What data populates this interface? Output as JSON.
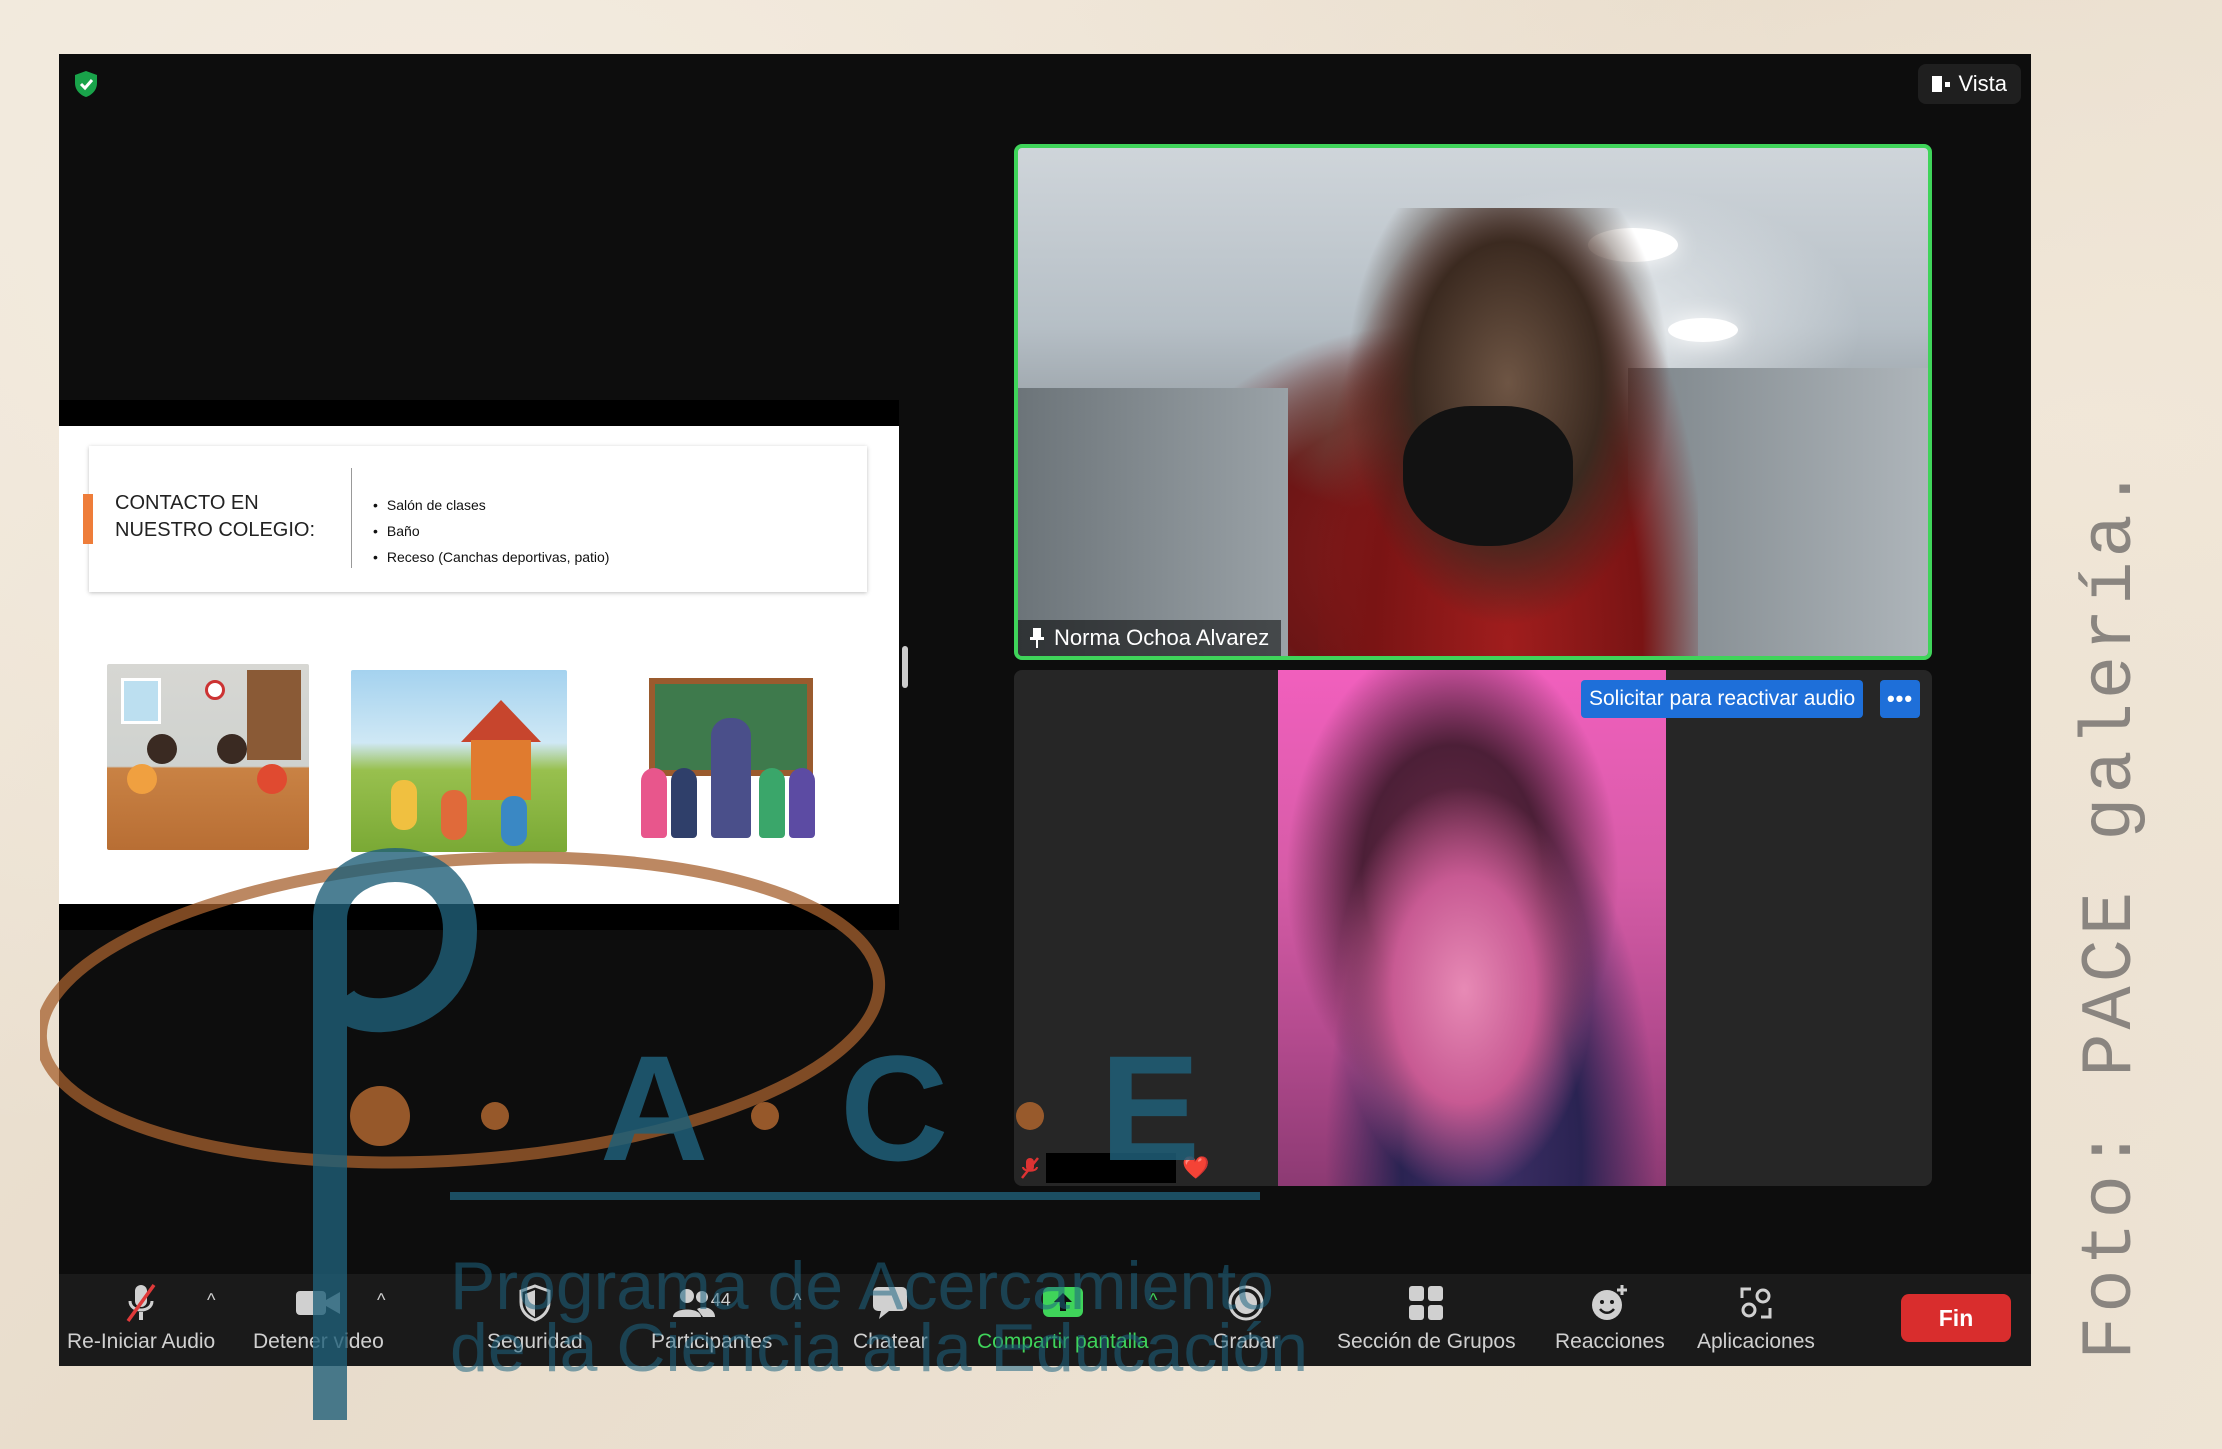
{
  "window": {
    "view_label": "Vista"
  },
  "slide": {
    "title": "CONTACTO EN\nNUESTRO COLEGIO:",
    "bullets": [
      "Salón de clases",
      "Baño",
      "Receso (Canchas deportivas, patio)"
    ]
  },
  "participants": {
    "main_name": "Norma Ochoa Alvarez",
    "audio_request_label": "Solicitar para reactivar audio",
    "more_label": "•••",
    "heart": "❤️"
  },
  "toolbar": {
    "audio": "Re-Iniciar Audio",
    "video": "Detener video",
    "security": "Seguridad",
    "participants": "Participantes",
    "participant_count": "44",
    "chat": "Chatear",
    "share": "Compartir pantalla",
    "record": "Grabar",
    "breakout": "Sección de Grupos",
    "reactions": "Reacciones",
    "apps": "Aplicaciones",
    "end": "Fin"
  },
  "caption": "Foto: PACE galería.",
  "watermark": {
    "letters": [
      "A",
      "C",
      "E"
    ],
    "line1": "Programa de Acercamiento",
    "line2": "de la Ciencia a la Educación",
    "colors": {
      "brown": "#a5602e",
      "teal": "#1f5f78"
    }
  },
  "colors": {
    "active_speaker_border": "#3fd45a",
    "accent_blue": "#1e6fd9",
    "end_red": "#d92d2d",
    "slide_accent": "#ee7d3a"
  }
}
